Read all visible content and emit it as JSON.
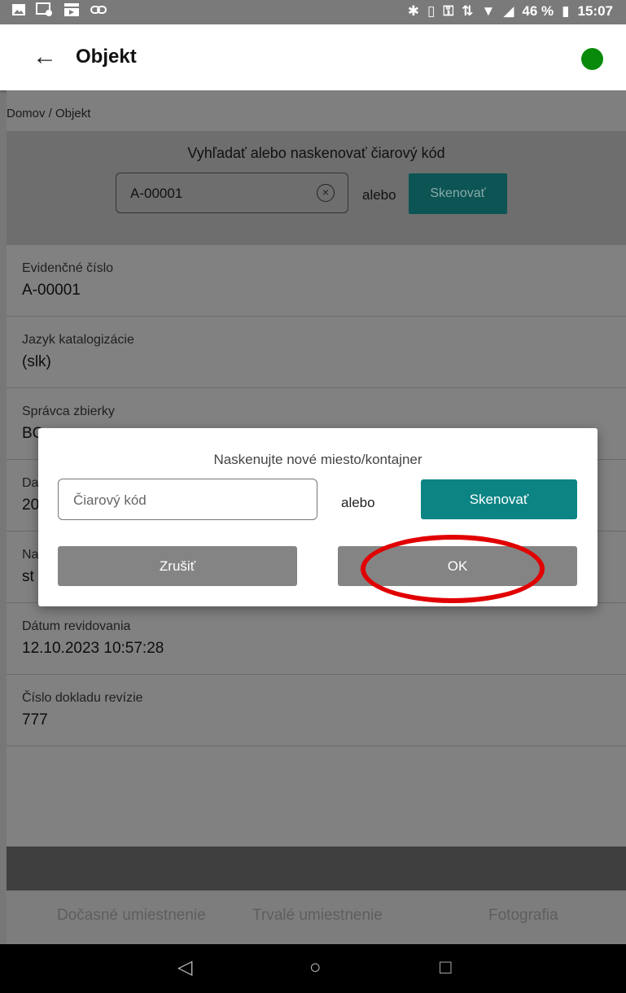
{
  "status_bar": {
    "left_icons": [
      "image-icon",
      "screenshot-icon",
      "media-icon",
      "link-icon"
    ],
    "right_icons": [
      "bluetooth-icon",
      "vibrate-icon",
      "vpn-key-icon",
      "data-icon",
      "wifi-icon",
      "signal-icon",
      "battery-icon"
    ],
    "battery": "46 %",
    "time": "15:07"
  },
  "app_bar": {
    "title": "Objekt",
    "status_color": "#0a8a0a"
  },
  "breadcrumb": "Domov / Objekt",
  "search": {
    "prompt": "Vyhľadať alebo naskenovať čiarový kód",
    "value": "A-00001",
    "or": "alebo",
    "scan_label": "Skenovať"
  },
  "fields": [
    {
      "label": "Evidenčné číslo",
      "value": "A-00001"
    },
    {
      "label": "Jazyk katalogizácie",
      "value": "(slk)"
    },
    {
      "label": "Správca zbierky",
      "value": "BC"
    },
    {
      "label": "Da",
      "value": "20"
    },
    {
      "label": "Na",
      "value": "st"
    },
    {
      "label": "Dátum revidovania",
      "value": "12.10.2023 10:57:28"
    },
    {
      "label": "Číslo dokladu revízie",
      "value": "777"
    }
  ],
  "tabs": [
    "Dočasné umiestnenie",
    "Trvalé umiestnenie",
    "Fotografia"
  ],
  "dialog": {
    "title": "Naskenujte nové miesto/kontajner",
    "input_placeholder": "Čiarový kód",
    "or": "alebo",
    "scan_label": "Skenovať",
    "cancel_label": "Zrušiť",
    "ok_label": "OK"
  },
  "colors": {
    "accent": "#0c8484",
    "highlight": "#e10000"
  }
}
